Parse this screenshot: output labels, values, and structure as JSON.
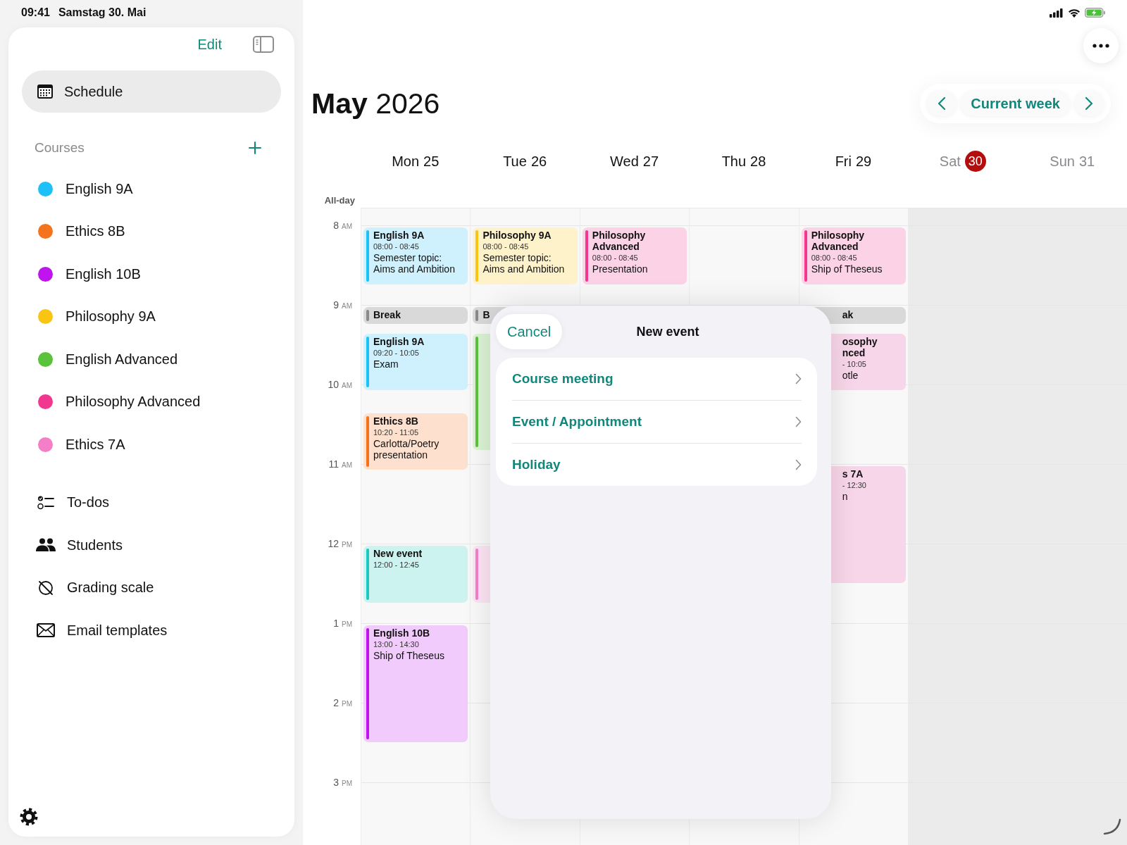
{
  "status_bar": {
    "time": "09:41",
    "date": "Samstag 30. Mai"
  },
  "sidebar": {
    "edit": "Edit",
    "nav": [
      {
        "label": "Schedule",
        "selected": true
      }
    ],
    "courses_header": "Courses",
    "courses": [
      {
        "label": "English 9A",
        "color": "#1ec0f8"
      },
      {
        "label": "Ethics 8B",
        "color": "#f5731c"
      },
      {
        "label": "English 10B",
        "color": "#c014ee"
      },
      {
        "label": "Philosophy 9A",
        "color": "#f9c513"
      },
      {
        "label": "English Advanced",
        "color": "#5bc23b"
      },
      {
        "label": "Philosophy Advanced",
        "color": "#f2378f"
      },
      {
        "label": "Ethics 7A",
        "color": "#f47fc8"
      }
    ],
    "tools": [
      {
        "label": "To-dos",
        "selected": false
      },
      {
        "label": "Students",
        "selected": false
      },
      {
        "label": "Grading scale",
        "selected": false
      },
      {
        "label": "Email templates",
        "selected": false
      }
    ]
  },
  "header": {
    "title": "**May** 2026",
    "current_week": "Current week"
  },
  "all_day_label": "All-day",
  "hours": [
    {
      "hour": "8",
      "period": "AM"
    },
    {
      "hour": "9",
      "period": "AM"
    },
    {
      "hour": "10",
      "period": "AM"
    },
    {
      "hour": "11",
      "period": "AM"
    },
    {
      "hour": "12",
      "period": "PM"
    },
    {
      "hour": "1",
      "period": "PM"
    },
    {
      "hour": "2",
      "period": "PM"
    },
    {
      "hour": "3",
      "period": "PM"
    }
  ],
  "days": [
    {
      "weekday": "Mon",
      "date": "25",
      "today": false,
      "weekend": false,
      "events": [
        {
          "kind": "lesson",
          "title": "English 9A",
          "time": "08:00 - 08:45",
          "note": "Semester topic: Aims and Ambition",
          "color": "#1ec0f8"
        },
        {
          "kind": "break",
          "title": "Break",
          "color": "#8a8a8a"
        },
        {
          "kind": "lesson",
          "title": "English 9A",
          "time": "09:20 - 10:05",
          "note": "Exam",
          "color": "#1ec0f8"
        },
        {
          "kind": "lesson",
          "title": "Ethics 8B",
          "time": "10:20 - 11:05",
          "note": "Carlotta/Poetry presentation",
          "color": "#f5731c"
        },
        {
          "kind": "lesson",
          "title": "New event",
          "time": "12:00 - 12:45",
          "color": "#1cc8c0"
        },
        {
          "kind": "lesson",
          "title": "English 10B",
          "time": "13:00 - 14:30",
          "note": "Ship of Theseus",
          "color": "#c014ee"
        }
      ]
    },
    {
      "weekday": "Tue",
      "date": "26",
      "today": false,
      "weekend": false,
      "events": [
        {
          "kind": "lesson",
          "title": "Philosophy 9A",
          "time": "08:00 - 08:45",
          "note": "Semester topic: Aims and Ambition",
          "color": "#f9c513"
        },
        {
          "kind": "break",
          "title": "B",
          "color": "#8a8a8a"
        },
        {
          "kind": "lesson",
          "color": "#5bc23b"
        },
        {
          "kind": "lesson",
          "color": "#f47fc8"
        }
      ]
    },
    {
      "weekday": "Wed",
      "date": "27",
      "today": false,
      "weekend": false,
      "events": [
        {
          "kind": "lesson",
          "title": "Philosophy Advanced",
          "time": "08:00 - 08:45",
          "note": "Presentation",
          "color": "#f2378f"
        }
      ]
    },
    {
      "weekday": "Thu",
      "date": "28",
      "today": false,
      "weekend": false
    },
    {
      "weekday": "Fri",
      "date": "29",
      "today": false,
      "weekend": false,
      "events": [
        {
          "kind": "lesson",
          "title": "Philosophy Advanced",
          "time": "08:00 - 08:45",
          "note": "Ship of Theseus",
          "color": "#f2378f"
        },
        {
          "kind": "break-cut",
          "title": "ak"
        },
        {
          "kind": "lesson-cut",
          "title": "osophy\nnced",
          "time": "- 10:05",
          "note": "otle"
        },
        {
          "kind": "lesson-cut",
          "title": "s 7A",
          "time": "- 12:30",
          "note": "n"
        }
      ]
    },
    {
      "weekday": "Sat",
      "date": "30",
      "today": true,
      "weekend": true
    },
    {
      "weekday": "Sun",
      "date": "31",
      "today": false,
      "weekend": true
    }
  ],
  "sheet": {
    "cancel": "Cancel",
    "title": "New event",
    "options": [
      "Course meeting",
      "Event / Appointment",
      "Holiday"
    ]
  }
}
